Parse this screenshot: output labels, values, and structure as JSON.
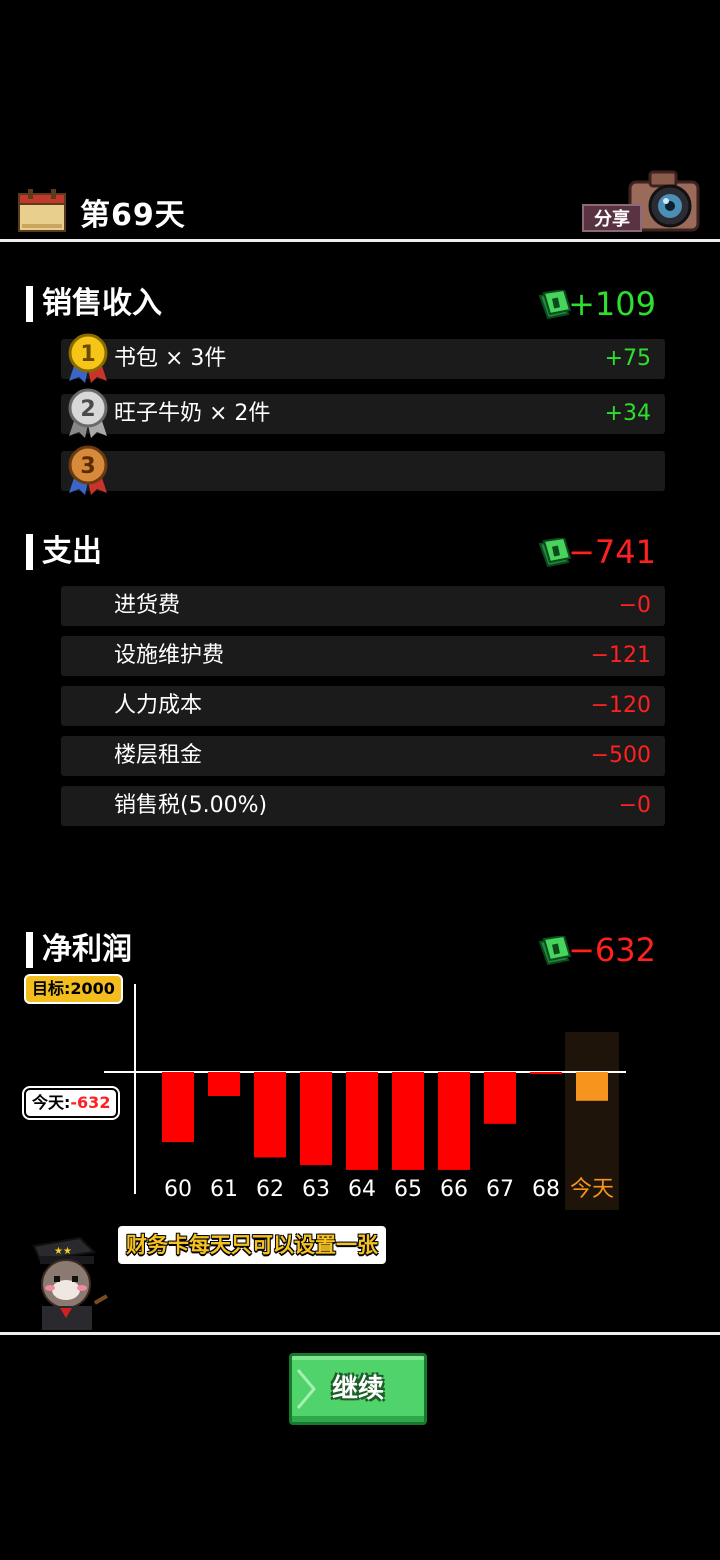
{
  "header": {
    "day_title": "第69天",
    "share_label": "分享"
  },
  "income": {
    "title": "销售收入",
    "total": "+109",
    "items": [
      {
        "rank": "1",
        "label": "书包 × 3件",
        "value": "+75"
      },
      {
        "rank": "2",
        "label": "旺子牛奶 × 2件",
        "value": "+34"
      },
      {
        "rank": "3",
        "label": "",
        "value": ""
      }
    ]
  },
  "expense": {
    "title": "支出",
    "total": "−741",
    "items": [
      {
        "label": "进货费",
        "value": "−0"
      },
      {
        "label": "设施维护费",
        "value": "−121"
      },
      {
        "label": "人力成本",
        "value": "−120"
      },
      {
        "label": "楼层租金",
        "value": "−500"
      },
      {
        "label": "销售税(5.00%)",
        "value": "−0"
      }
    ]
  },
  "profit": {
    "title": "净利润",
    "total": "−632",
    "target_label": "目标:2000",
    "today_prefix": "今天:",
    "today_value": "-632"
  },
  "chart_data": {
    "type": "bar",
    "categories": [
      "60",
      "61",
      "62",
      "63",
      "64",
      "65",
      "66",
      "67",
      "68",
      "今天"
    ],
    "values": [
      -730,
      -250,
      -890,
      -970,
      -1020,
      -1020,
      -1020,
      -540,
      -10,
      -300
    ],
    "target": 2000,
    "highlight_category": "今天",
    "colors": {
      "bar": "#ff0000",
      "today_bar": "#f7941d",
      "today_column": "#1f140a",
      "today_label": "#f7941d",
      "axis": "#ffffff"
    }
  },
  "tip": {
    "text": "财务卡每天只可以设置一张"
  },
  "footer": {
    "continue_label": "继续"
  },
  "colors": {
    "positive": "#2ee02e",
    "negative": "#ff2020",
    "row_bg": "#1b1b1b",
    "button_green": "#4fd36a"
  }
}
